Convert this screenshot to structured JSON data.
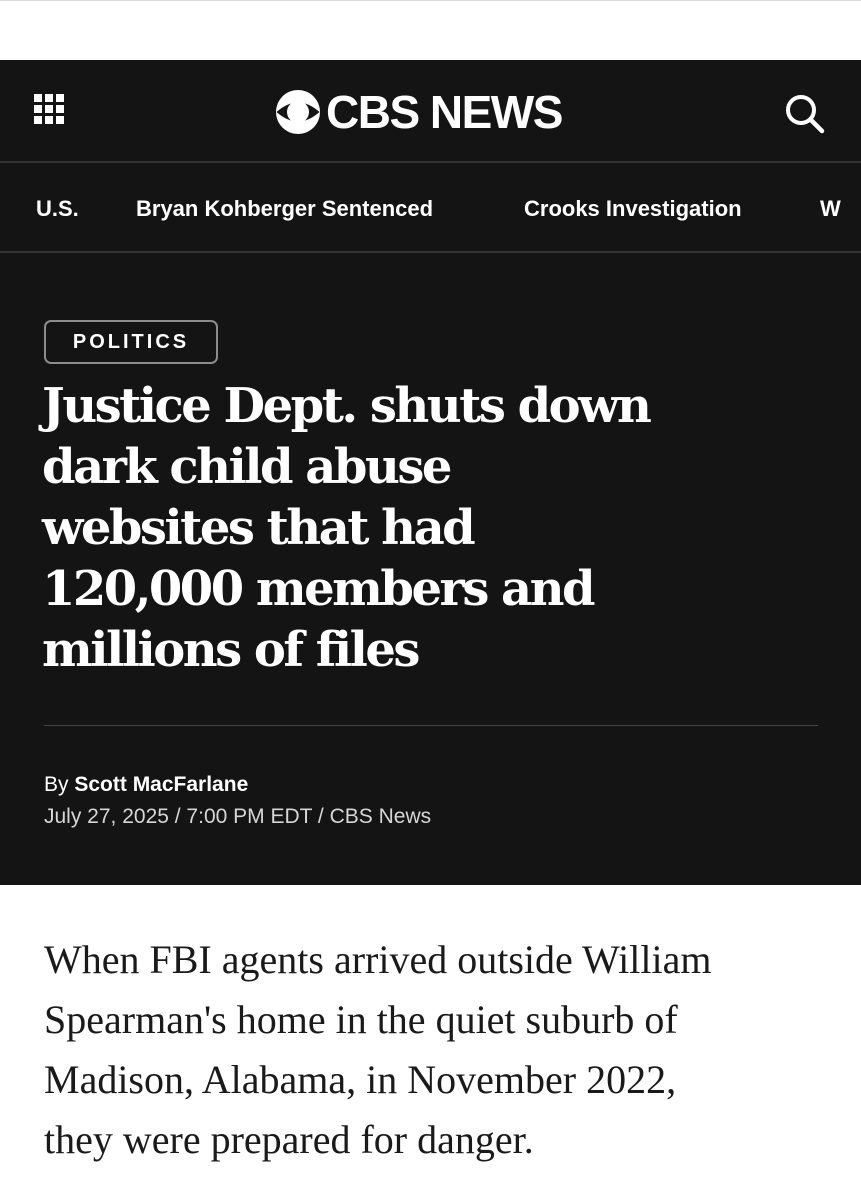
{
  "header": {
    "brand_text": "CBS NEWS",
    "grid_icon": "grid-menu-icon",
    "search_icon": "search-icon",
    "bg_color": "#141414"
  },
  "nav": {
    "items": [
      {
        "label": "U.S."
      },
      {
        "label": "Bryan Kohberger Sentenced"
      },
      {
        "label": "Crooks Investigation"
      },
      {
        "label": "W"
      }
    ]
  },
  "article": {
    "category": "POLITICS",
    "headline_lines": [
      "Justice Dept. shuts down",
      "dark child abuse",
      "websites that had",
      "120,000 members and",
      "millions of files"
    ],
    "by_prefix": "By",
    "author": "Scott MacFarlane",
    "meta": "July 27, 2025 / 7:00 PM EDT / CBS News",
    "body_lines": [
      "When FBI agents arrived outside William",
      "Spearman's home in the quiet suburb of",
      "Madison, Alabama, in November 2022,",
      "they were prepared for danger."
    ]
  }
}
